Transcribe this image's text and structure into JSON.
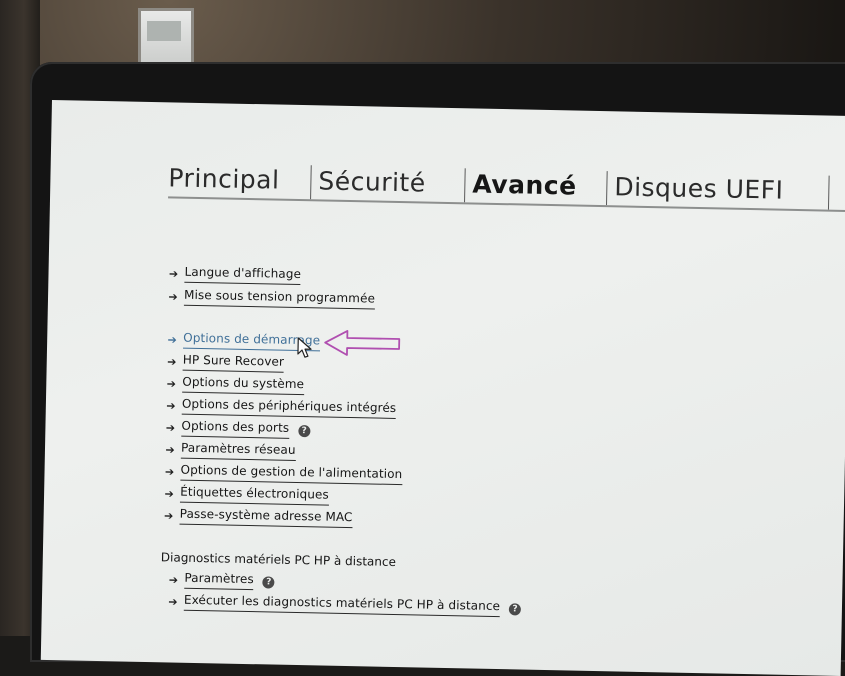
{
  "tabs": [
    {
      "label": "Principal"
    },
    {
      "label": "Sécurité"
    },
    {
      "label": "Avancé"
    },
    {
      "label": "Disques UEFI"
    }
  ],
  "menu": {
    "items": [
      {
        "label": "Langue d'affichage"
      },
      {
        "label": "Mise sous tension programmée"
      },
      {
        "label": "Options de démarrage"
      },
      {
        "label": "HP Sure Recover"
      },
      {
        "label": "Options du système"
      },
      {
        "label": "Options des périphériques intégrés"
      },
      {
        "label": "Options des ports"
      },
      {
        "label": "Paramètres réseau"
      },
      {
        "label": "Options de gestion de l'alimentation"
      },
      {
        "label": "Étiquettes électroniques"
      },
      {
        "label": "Passe-système adresse MAC"
      }
    ]
  },
  "diagnostics": {
    "title": "Diagnostics matériels PC HP à distance",
    "items": [
      {
        "label": "Paramètres"
      },
      {
        "label": "Exécuter les diagnostics matériels PC HP à distance"
      }
    ]
  },
  "icons": {
    "menu_arrow": "arrow-right-icon",
    "help": "question-circle-icon",
    "annotation": "outline-arrow-left-icon",
    "cursor": "mouse-pointer-icon"
  },
  "colors": {
    "screen_bg": "#eceeec",
    "text": "#151515",
    "selected": "#3f6f98",
    "annotation": "#b04fb0"
  }
}
